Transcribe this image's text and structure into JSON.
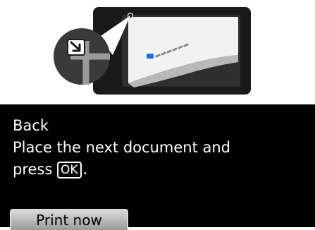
{
  "message": {
    "line1": "Back",
    "line2": "Place the next document and",
    "line3_prefix": "press",
    "ok_key": "OK",
    "line3_suffix": "."
  },
  "softkey": {
    "label": "Print now"
  },
  "illustration": {
    "icon": "place-document-icon",
    "corner_icon": "corner-arrow-icon"
  },
  "colors": {
    "panel_background": "#000000",
    "text": "#ffffff",
    "scanner_body": "#1a1a1a",
    "glass": "#2e2e2e",
    "indicator": "#1e6fd9"
  }
}
